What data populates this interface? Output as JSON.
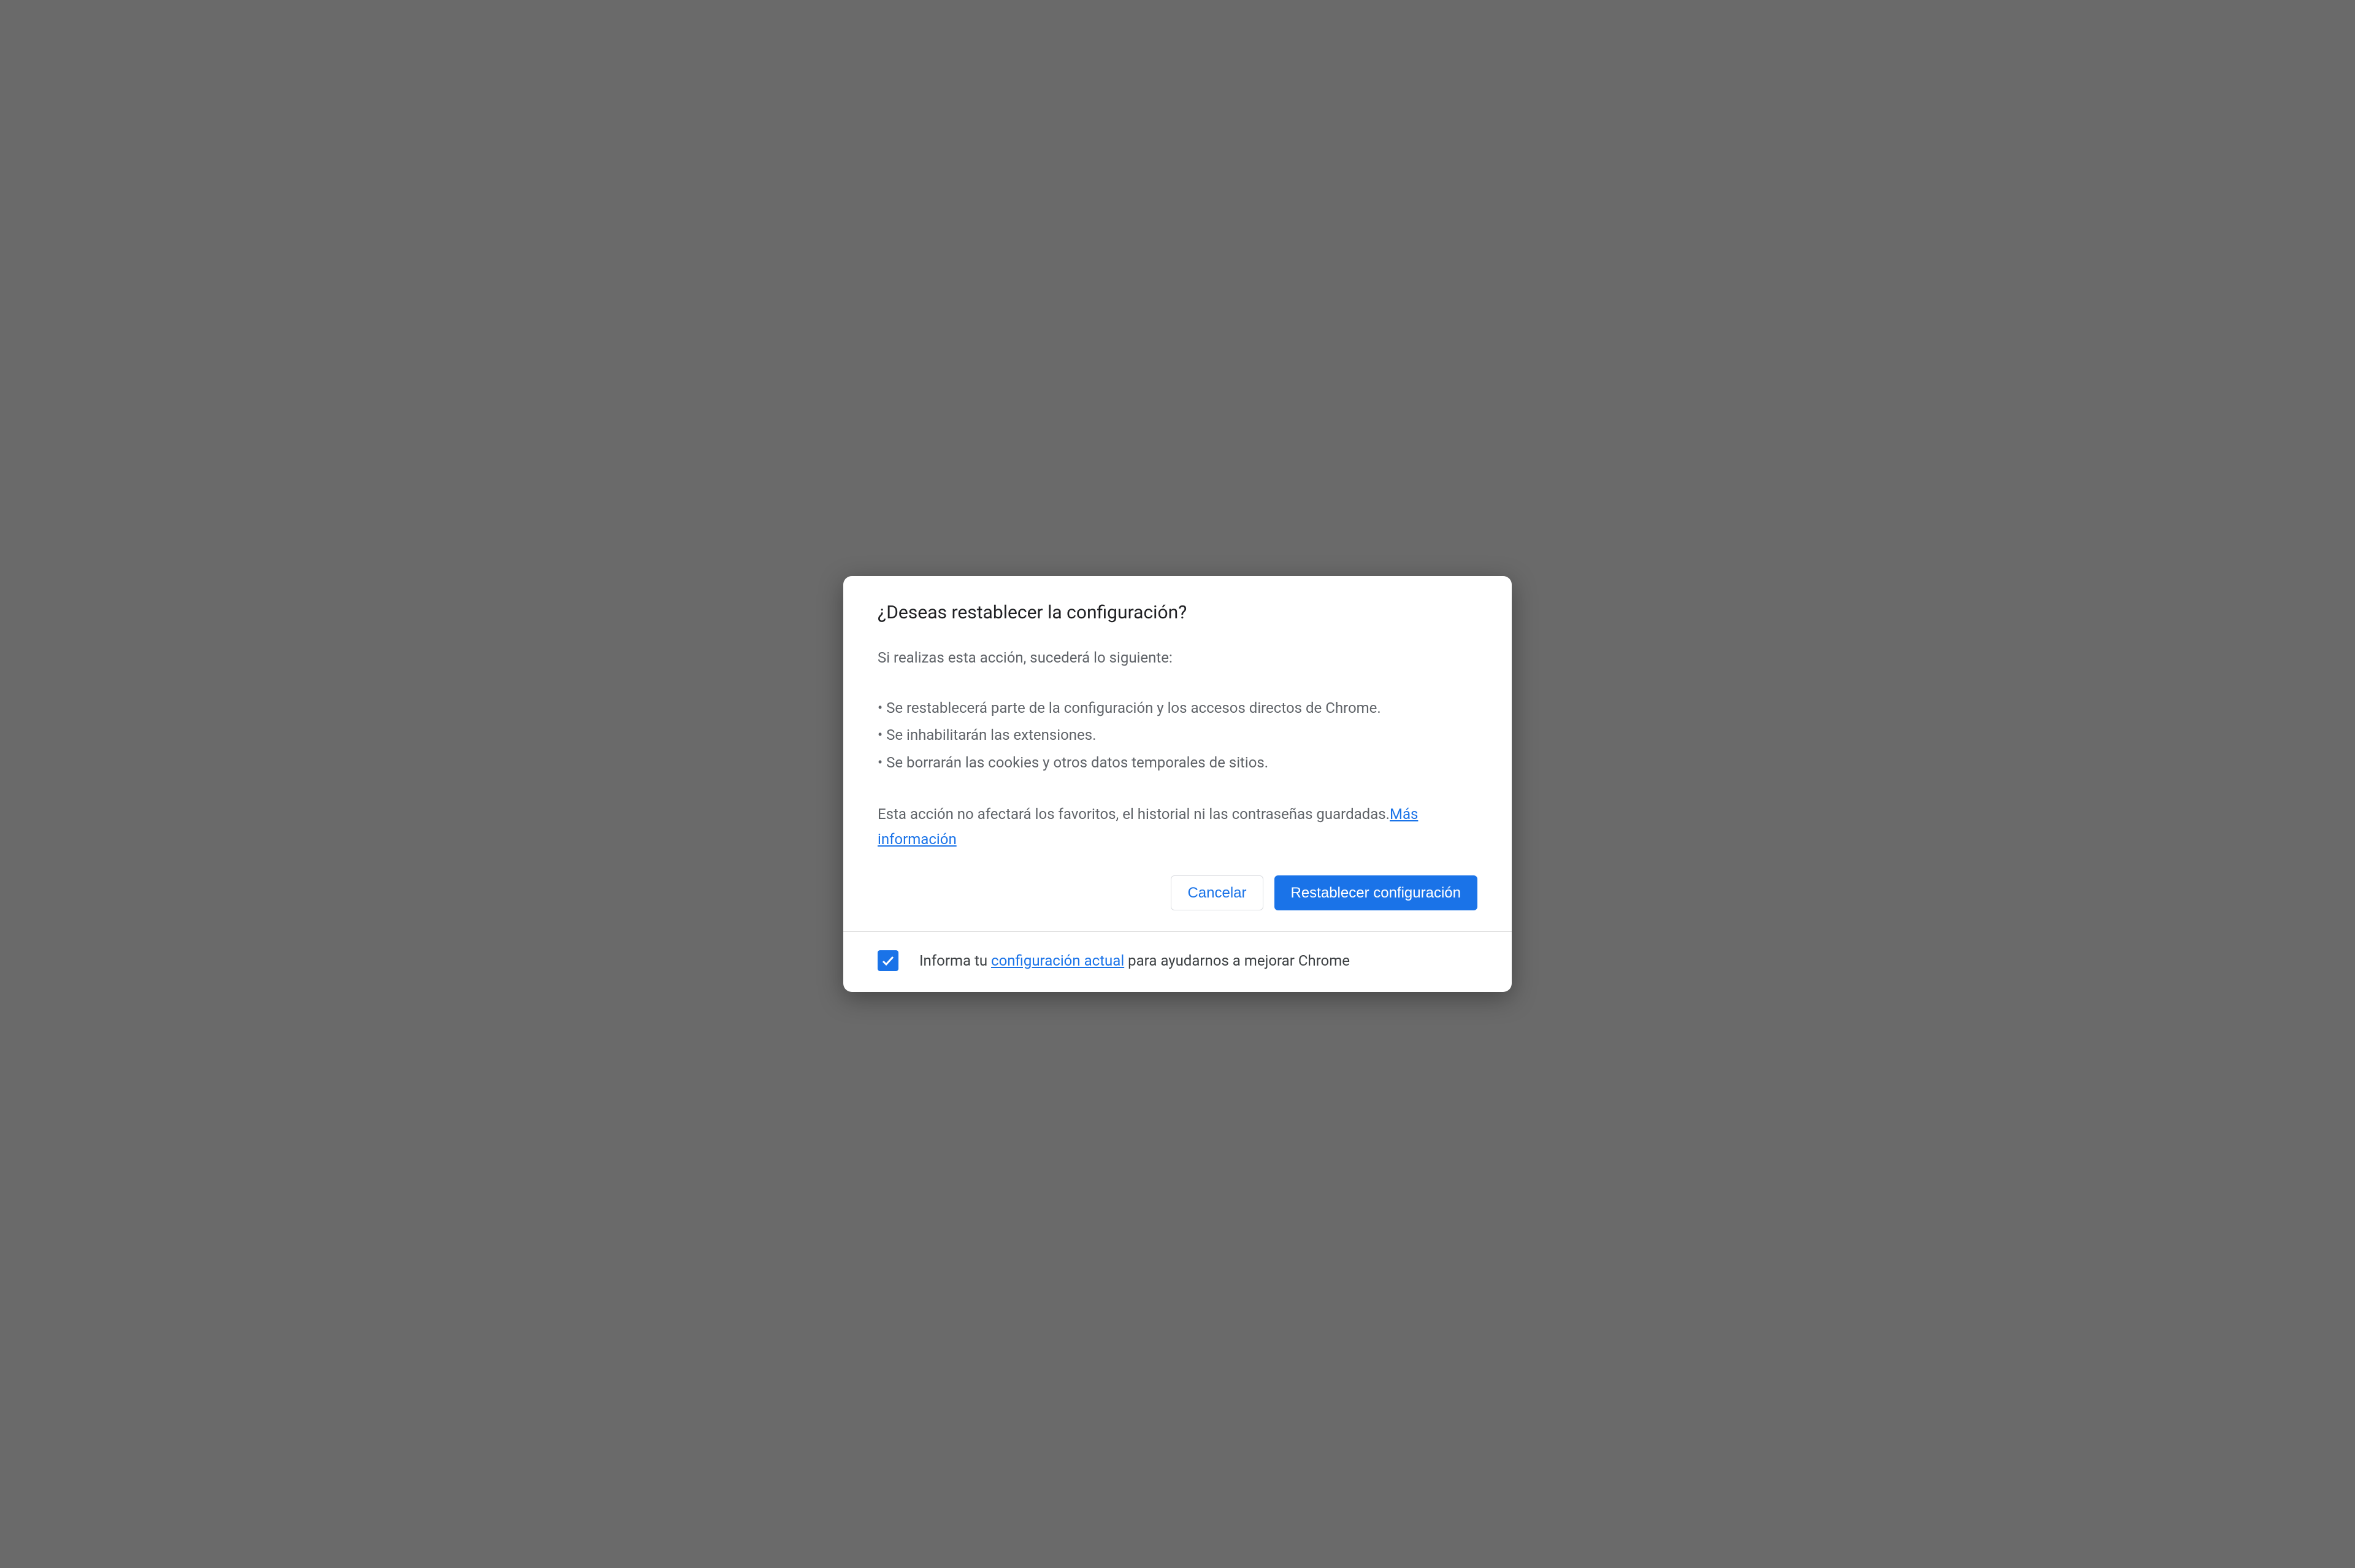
{
  "dialog": {
    "title": "¿Deseas restablecer la configuración?",
    "intro": "Si realizas esta acción, sucederá lo siguiente:",
    "bullets": [
      "Se restablecerá parte de la configuración y los accesos directos de Chrome.",
      "Se inhabilitarán las extensiones.",
      "Se borrarán las cookies y otros datos temporales de sitios."
    ],
    "note_before_link": "Esta acción no afectará los favoritos, el historial ni las contraseñas guardadas.",
    "more_info_link": "Más información",
    "cancel_label": "Cancelar",
    "confirm_label": "Restablecer configuración",
    "report": {
      "checked": true,
      "text_before": "Informa tu ",
      "link_text": "configuración actual",
      "text_after": " para ayudarnos a mejorar Chrome"
    }
  }
}
